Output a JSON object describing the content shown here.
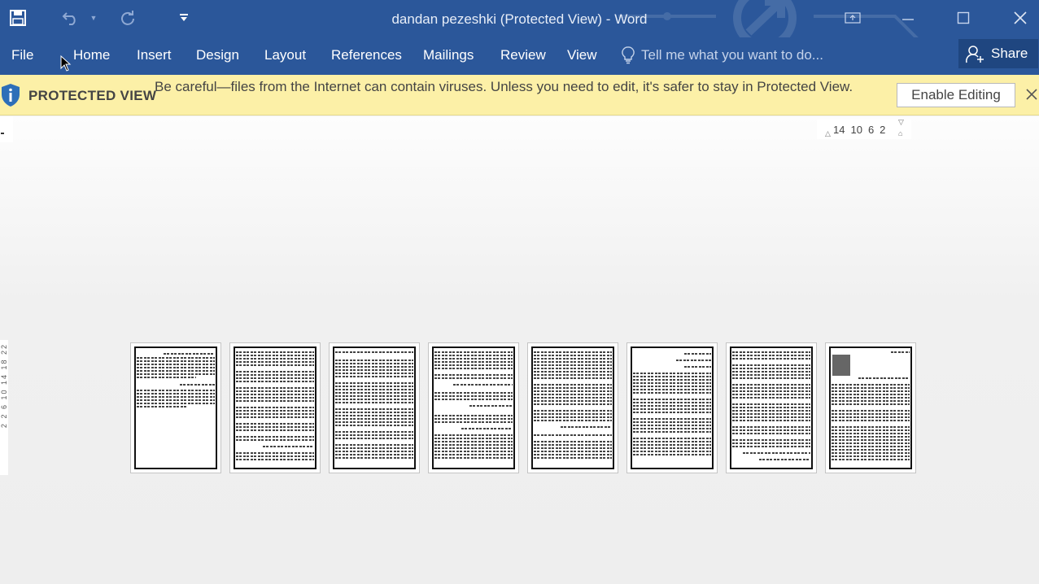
{
  "window": {
    "title": "dandan pezeshki (Protected View) - Word",
    "theme_color": "#2b579a"
  },
  "quick_access": {
    "icons": [
      "save-icon",
      "undo-icon",
      "undo-dropdown-icon",
      "redo-icon",
      "customize-qat-icon"
    ]
  },
  "window_controls": {
    "icons": [
      "ribbon-display-options-icon",
      "minimize-icon",
      "maximize-icon",
      "close-icon"
    ]
  },
  "ribbon": {
    "tabs": [
      {
        "label": "File"
      },
      {
        "label": "Home"
      },
      {
        "label": "Insert"
      },
      {
        "label": "Design"
      },
      {
        "label": "Layout"
      },
      {
        "label": "References"
      },
      {
        "label": "Mailings"
      },
      {
        "label": "Review"
      },
      {
        "label": "View"
      }
    ],
    "tell_me_placeholder": "Tell me what you want to do...",
    "share_label": "Share"
  },
  "protected_view": {
    "title": "PROTECTED VIEW",
    "message": "Be careful—files from the Internet can contain viruses. Unless you need to edit, it's safer to stay in Protected View.",
    "enable_label": "Enable Editing",
    "background": "#fcf0a7"
  },
  "ruler": {
    "horizontal_numbers": [
      "14",
      "10",
      "6",
      "2"
    ],
    "vertical_numbers": "2 2 6 10 14 18 22"
  },
  "document": {
    "page_count": 8
  }
}
